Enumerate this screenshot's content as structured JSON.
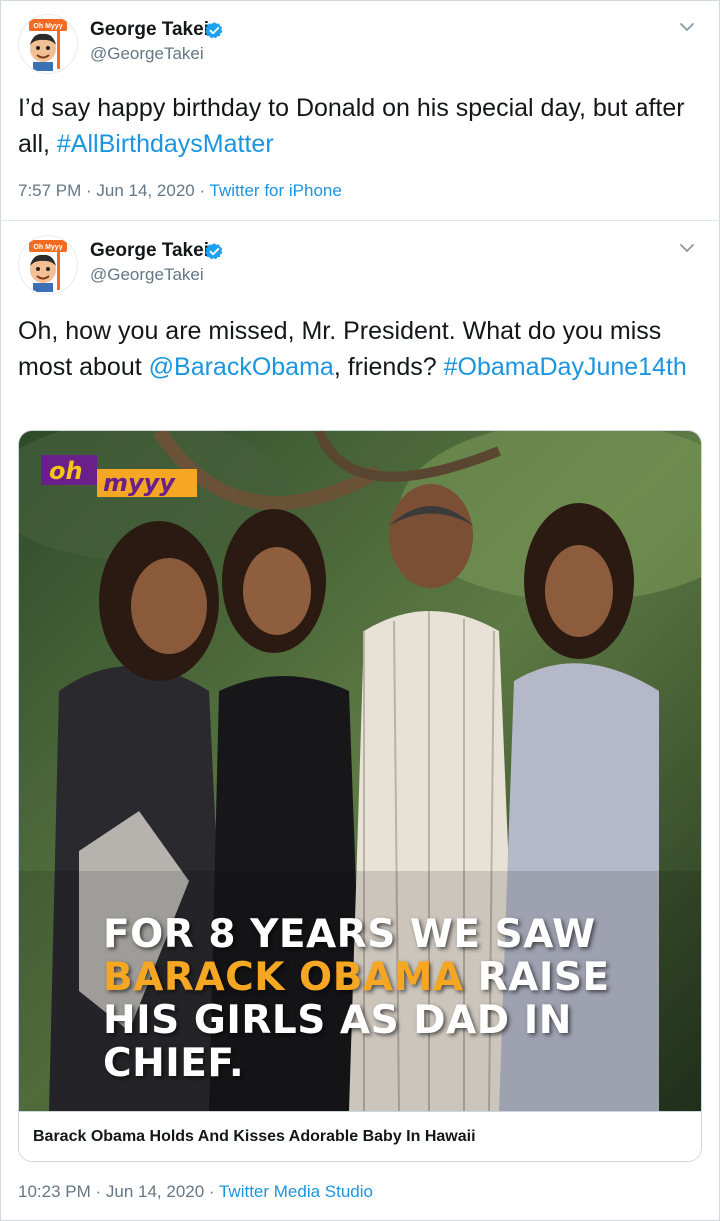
{
  "tweets": [
    {
      "name": "George Takei",
      "handle": "@GeorgeTakei",
      "avatar_badge": "Oh Myyy",
      "text_before": "I’d say happy birthday to Donald on his special day, but after all, ",
      "hashtag": "#AllBirthdaysMatter",
      "time": "7:57 PM · Jun 14, 2020 · ",
      "source": "Twitter for iPhone"
    },
    {
      "name": "George Takei",
      "handle": "@GeorgeTakei",
      "avatar_badge": "Oh Myyy",
      "text_before": "Oh, how you are missed, Mr. President. What do you miss most about ",
      "mention": "@BarackObama",
      "text_after": ", friends? ",
      "hashtag": "#ObamaDayJune14th",
      "time": "10:23 PM · Jun 14, 2020 · ",
      "source": "Twitter Media Studio",
      "card": {
        "logo_top": "oh",
        "logo_bottom": "myyy",
        "overlay_line1": "FOR 8 YEARS WE SAW",
        "overlay_highlight": "BARACK OBAMA",
        "overlay_line2_rest": " RAISE",
        "overlay_line3": "HIS GIRLS AS DAD IN",
        "overlay_line4": "CHIEF.",
        "title": "Barack Obama Holds And Kisses Adorable Baby In Hawaii"
      }
    }
  ],
  "colors": {
    "link": "#1b95e0",
    "verified": "#1da1f2",
    "highlight": "#f5a623",
    "logo_purple": "#6b1f8a"
  },
  "icons": {
    "verified": "verified-badge-icon",
    "caret": "chevron-down-icon"
  }
}
